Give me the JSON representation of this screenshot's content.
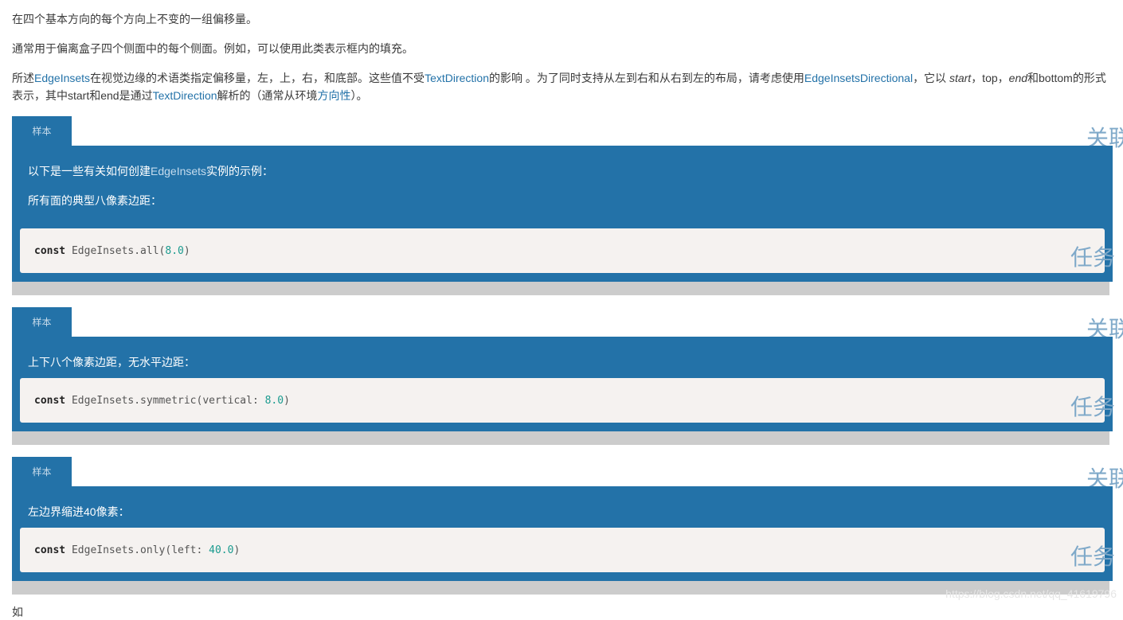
{
  "intro": {
    "p1": "在四个基本方向的每个方向上不变的一组偏移量。",
    "p2": "通常用于偏离盒子四个侧面中的每个侧面。例如，可以使用此类表示框内的填充。",
    "p3": {
      "t1": "所述",
      "l1": "EdgeInsets",
      "t2": "在视觉边缘的术语类指定偏移量，左，上，右，和底部。这些值不受",
      "l2": "TextDirection",
      "t3": "的影响 。为了同时支持从左到右和从右到左的布局，请考虑使用",
      "l3": "EdgeInsetsDirectional",
      "t4": "，它以 ",
      "e1": "start",
      "t5": "，top，",
      "e2": "end",
      "t6": "和bottom的形式表示，其中start和end是通过",
      "l4": "TextDirection",
      "t7": "解析的（通常从环境",
      "l5": "方向性",
      "t8": "）。"
    }
  },
  "samples": [
    {
      "tab": "样本",
      "intro_pre": "以下是一些有关如何创建",
      "intro_link": "EdgeInsets",
      "intro_post": "实例的示例：",
      "desc": "所有面的典型八像素边距：",
      "code": {
        "kw": "const",
        "pre": " EdgeInsets.all(",
        "num": "8.0",
        "post": ")"
      },
      "side_top": "关联",
      "side_code": "任务"
    },
    {
      "tab": "样本",
      "desc": "上下八个像素边距，无水平边距：",
      "code": {
        "kw": "const",
        "pre": " EdgeInsets.symmetric(vertical: ",
        "num": "8.0",
        "post": ")"
      },
      "side_top": "关联",
      "side_code": "任务"
    },
    {
      "tab": "样本",
      "desc": "左边界缩进40像素：",
      "code": {
        "kw": "const",
        "pre": " EdgeInsets.only(left: ",
        "num": "40.0",
        "post": ")"
      },
      "side_top": "关联",
      "side_code": "任务"
    }
  ],
  "footer": {
    "watermark": "https://blog.csdn.net/qq_41619796",
    "cut_text": "如"
  },
  "colors": {
    "accent": "#2372a8",
    "link": "#2372a8",
    "code_bg": "#f5f2f0",
    "number": "#1a9b8f"
  }
}
